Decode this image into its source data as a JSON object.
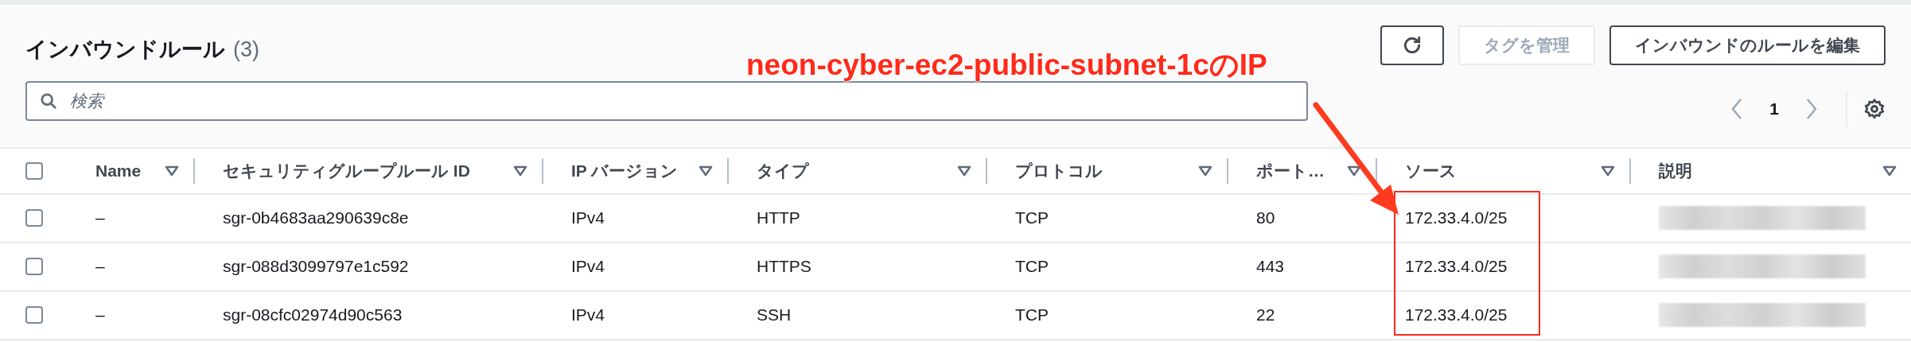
{
  "header": {
    "title": "インバウンドルール",
    "count": "(3)"
  },
  "buttons": [
    {
      "kind": "icon",
      "disabled": false
    },
    {
      "kind": "text",
      "label": "タグを管理",
      "disabled": true
    },
    {
      "kind": "text",
      "label": "インバウンドのルールを編集",
      "disabled": false
    }
  ],
  "search": {
    "placeholder": "検索"
  },
  "pagination": {
    "page": "1",
    "prev_disabled": true,
    "next_disabled": true
  },
  "table": {
    "select_all_checked": false,
    "columns": [
      "Name",
      "セキュリティグループルール ID",
      "IP バージョン",
      "タイプ",
      "プロトコル",
      "ポート…",
      "ソース",
      "説明"
    ],
    "rows": [
      {
        "checked": false,
        "cells": [
          "–",
          "sgr-0b4683aa290639c8e",
          "IPv4",
          "HTTP",
          "TCP",
          "80",
          "172.33.4.0/25"
        ]
      },
      {
        "checked": false,
        "cells": [
          "–",
          "sgr-088d3099797e1c592",
          "IPv4",
          "HTTPS",
          "TCP",
          "443",
          "172.33.4.0/25"
        ]
      },
      {
        "checked": false,
        "cells": [
          "–",
          "sgr-08cfc02974d90c563",
          "IPv4",
          "SSH",
          "TCP",
          "22",
          "172.33.4.0/25"
        ]
      }
    ]
  },
  "annotation": {
    "text": "neon-cyber-ec2-public-subnet-1cのIP"
  }
}
